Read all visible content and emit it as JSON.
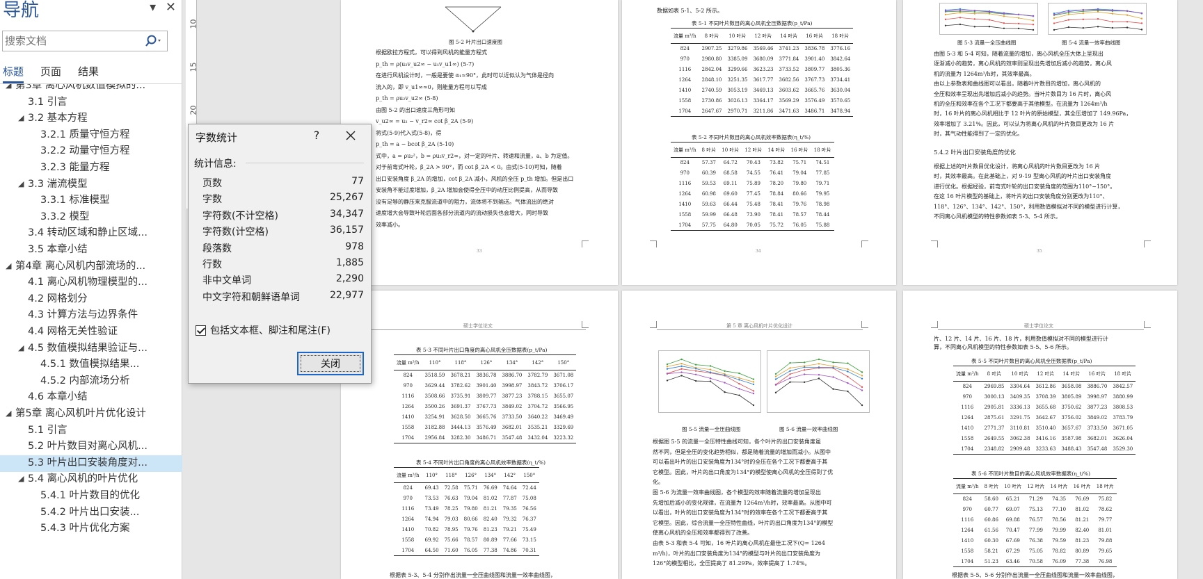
{
  "nav": {
    "title": "导航",
    "search_placeholder": "搜索文档",
    "tabs": [
      "标题",
      "页面",
      "结果"
    ],
    "items": [
      {
        "label": "第3章 离心风机数值模拟的...",
        "level": 1,
        "expanded": true
      },
      {
        "label": "3.1 引言",
        "level": 2
      },
      {
        "label": "3.2 基本方程",
        "level": 2,
        "expanded": true
      },
      {
        "label": "3.2.1 质量守恒方程",
        "level": 3
      },
      {
        "label": "3.2.2 动量守恒方程",
        "level": 3
      },
      {
        "label": "3.2.3 能量方程",
        "level": 3
      },
      {
        "label": "3.3 湍流模型",
        "level": 2,
        "expanded": true
      },
      {
        "label": "3.3.1 标准模型",
        "level": 3
      },
      {
        "label": "3.3.2 模型",
        "level": 3
      },
      {
        "label": "3.4 转动区域和静止区域...",
        "level": 2
      },
      {
        "label": "3.5 本章小结",
        "level": 2
      },
      {
        "label": "第4章 离心风机内部流场的...",
        "level": 1,
        "expanded": true
      },
      {
        "label": "4.1 离心风机物理模型的...",
        "level": 2
      },
      {
        "label": "4.2 网格划分",
        "level": 2
      },
      {
        "label": "4.3 计算方法与边界条件",
        "level": 2
      },
      {
        "label": "4.4 网格无关性验证",
        "level": 2
      },
      {
        "label": "4.5 数值模拟结果验证与...",
        "level": 2,
        "expanded": true
      },
      {
        "label": "4.5.1 数值模拟结果...",
        "level": 3
      },
      {
        "label": "4.5.2 内部流场分析",
        "level": 3
      },
      {
        "label": "4.6 本章小结",
        "level": 2
      },
      {
        "label": "第5章 离心风机叶片优化设计",
        "level": 1,
        "expanded": true
      },
      {
        "label": "5.1 引言",
        "level": 2
      },
      {
        "label": "5.2 叶片数目对离心风机...",
        "level": 2
      },
      {
        "label": "5.3 叶片出口安装角度对...",
        "level": 2,
        "selected": true
      },
      {
        "label": "5.4 离心风机的叶片优化",
        "level": 2,
        "expanded": true
      },
      {
        "label": "5.4.1 叶片数目的优化",
        "level": 3
      },
      {
        "label": "5.4.2 叶片出口安装...",
        "level": 3
      },
      {
        "label": "5.4.3 叶片优化方案",
        "level": 3
      }
    ]
  },
  "ruler": [
    "10",
    "15",
    "20"
  ],
  "dialog": {
    "title": "字数统计",
    "help": "?",
    "subtitle": "统计信息:",
    "stats": [
      {
        "label": "页数",
        "value": "77"
      },
      {
        "label": "字数",
        "value": "25,267"
      },
      {
        "label": "字符数(不计空格)",
        "value": "34,347"
      },
      {
        "label": "字符数(计空格)",
        "value": "36,157"
      },
      {
        "label": "段落数",
        "value": "978"
      },
      {
        "label": "行数",
        "value": "1,885"
      },
      {
        "label": "非中文单词",
        "value": "2,290"
      },
      {
        "label": "中文字符和朝鲜语单词",
        "value": "22,977"
      }
    ],
    "checkbox_label": "包括文本框、脚注和尾注(F)",
    "checkbox_checked": true,
    "close_label": "关闭"
  },
  "pages": {
    "p1": {
      "caption": "图 5-2 叶片出口速度图",
      "lines": [
        "根据欧拉方程式，可以得到风机的能量方程式",
        "p_th = ρ(u₂v_u2∞ − u₁v_u1∞)                         (5-7)",
        "在进行风机设计时，一般是要使 α₁≈90°，此时可以近似认为气体是径向",
        "流入的，即 v_u1∞≈0，则能量方程可以写成",
        "p_th = ρu₂v_u2∞                                      (5-8)",
        "由图 5-2 的出口速度三角形可知",
        "v_u2∞ = u₂ − v_r2∞ cot β_2A                          (5-9)",
        "将式(5-9)代入式(5-8)，得",
        "p_th = a − bcot β_2A                                 (5-10)",
        "式中，a = ρu₂²，b = ρu₂v_r2∞，对一定的叶片、转速和流量，a、b 为定值。",
        "对于前弯式叶轮，β_2A > 90°，而 cot β_2A < 0。由式(5-10)可知，随着",
        "出口安装角度 β_2A 的增加，cot β_2A 减小，风机的全压 p_th 增加。但是出口",
        "安装角不能过度增加，β_2A 增加会使得全压中的动压比例提高，从而导致",
        "没有足够的静压来克服流道中的阻力，流体将不到输送。气体流出的绝对",
        "速度增大会导致叶轮后面各部分流道内的流动损失也会增大，同时导致",
        "效率减小。"
      ],
      "footer": "33"
    },
    "p2": {
      "intro": "数据如表 5-1、5-2 所示。",
      "t1_caption": "表 5-1 不同叶片数目的离心风机全压数据表(p_t/Pa)",
      "t2_caption": "表 5-2 不同叶片数目的离心风机效率数据表(η_t/%)",
      "head": [
        "流量 m³/h",
        "8 叶片",
        "10 叶片",
        "12 叶片",
        "14 叶片",
        "16 叶片",
        "18 叶片"
      ],
      "t1_rows": [
        [
          "824",
          "2907.25",
          "3279.86",
          "3569.46",
          "3741.23",
          "3836.78",
          "3776.16"
        ],
        [
          "970",
          "2980.80",
          "3385.09",
          "3680.09",
          "3771.84",
          "3901.40",
          "3842.64"
        ],
        [
          "1116",
          "2842.04",
          "3299.66",
          "3623.23",
          "3733.52",
          "3809.77",
          "3805.36"
        ],
        [
          "1264",
          "2848.10",
          "3251.35",
          "3617.77",
          "3682.56",
          "3767.73",
          "3734.41"
        ],
        [
          "1410",
          "2740.59",
          "3053.19",
          "3469.13",
          "3603.62",
          "3665.76",
          "3630.04"
        ],
        [
          "1558",
          "2730.86",
          "3026.13",
          "3364.17",
          "3569.29",
          "3576.49",
          "3570.65"
        ],
        [
          "1704",
          "2647.67",
          "2970.71",
          "3211.86",
          "3471.63",
          "3486.71",
          "3478.94"
        ]
      ],
      "t2_rows": [
        [
          "824",
          "57.37",
          "64.72",
          "70.43",
          "73.82",
          "75.71",
          "74.51"
        ],
        [
          "970",
          "60.39",
          "68.58",
          "74.55",
          "76.41",
          "79.04",
          "77.85"
        ],
        [
          "1116",
          "59.53",
          "69.11",
          "75.89",
          "78.20",
          "79.80",
          "79.71"
        ],
        [
          "1264",
          "60.98",
          "69.60",
          "77.45",
          "78.84",
          "80.66",
          "79.95"
        ],
        [
          "1410",
          "59.63",
          "66.44",
          "75.48",
          "78.41",
          "79.76",
          "78.98"
        ],
        [
          "1558",
          "59.99",
          "66.48",
          "73.90",
          "78.41",
          "78.57",
          "78.44"
        ],
        [
          "1704",
          "57.75",
          "64.80",
          "70.05",
          "75.72",
          "76.05",
          "75.88"
        ]
      ],
      "footer": "34"
    },
    "p3": {
      "cap_a": "图 5-3 流量一全压曲线图",
      "cap_b": "图 5-4 流量一效率曲线图",
      "lines": [
        "由图 5-3 和 5-4 可知，随着流量的增加，离心风机全压大体上呈现出",
        "逐渐减小的趋势，离心风机的效率则呈现出先增加后减小的趋势，离心风",
        "机的流量为 1264m³/h时，其效率最高。",
        "由以上参数表和曲线图可以看出，随着叶片数目的增加，离心风机的",
        "全压和效率呈现出先增加后减小的趋势。当叶片数目为 16 片时，离心风",
        "机的全压和效率在各个工况下都要高于其他模型。在流量为 1264m³/h",
        "时，16 叶片的离心风机相比于 12 叶片的原始模型，其全压增加了 149.96Pa，",
        "效率增加了 3.21%。因此，可以认为将离心风机的叶片数目更改为 16 片",
        "时，其气动性能得到了一定的优化。"
      ],
      "section": "5.4.2 叶片出口安装角度的优化",
      "lines2": [
        "根据上述的叶片数目优化设计，将离心风机的叶片数目更改为 16 片",
        "时，其效率最高。在此基础上，对 9-19 型离心风机的叶片出口安装角度",
        "进行优化。根据经验，前弯式叶轮的出口安装角度的范围为110°~150°。",
        "在这 16 叶片模型的基础上，将叶片的出口安装角度分别更改为110°、",
        "118°、126°、134°、142°、150°，利用数值模拟对不同的模型进行计算，",
        "不同离心风机模型的特性参数如表 5-3、5-4 所示。"
      ],
      "footer": "35"
    },
    "p4": {
      "header": "硕士学位论文",
      "t3_caption": "表 5-3 不同叶片出口角度的离心风机全压数据表(p_t/Pa)",
      "t4_caption": "表 5-4 不同叶片出口角度的离心风机效率数据表(η_t/%)",
      "head": [
        "流量 m³/h",
        "110°",
        "118°",
        "126°",
        "134°",
        "142°",
        "150°"
      ],
      "t3_rows": [
        [
          "824",
          "3518.59",
          "3678.21",
          "3836.78",
          "3886.70",
          "3782.79",
          "3671.08"
        ],
        [
          "970",
          "3629.44",
          "3782.62",
          "3901.40",
          "3998.97",
          "3843.72",
          "3706.17"
        ],
        [
          "1116",
          "3508.66",
          "3735.91",
          "3809.77",
          "3877.23",
          "3788.15",
          "3655.07"
        ],
        [
          "1264",
          "3500.26",
          "3691.37",
          "3767.73",
          "3849.02",
          "3704.72",
          "3566.95"
        ],
        [
          "1410",
          "3254.91",
          "3628.50",
          "3665.76",
          "3733.50",
          "3640.22",
          "3469.49"
        ],
        [
          "1558",
          "3182.88",
          "3444.13",
          "3576.49",
          "3682.01",
          "3535.21",
          "3329.69"
        ],
        [
          "1704",
          "2956.84",
          "3282.30",
          "3486.71",
          "3547.48",
          "3432.04",
          "3223.32"
        ]
      ],
      "t4_rows": [
        [
          "824",
          "69.43",
          "72.58",
          "75.71",
          "76.69",
          "74.64",
          "72.44"
        ],
        [
          "970",
          "73.53",
          "76.63",
          "79.04",
          "81.02",
          "77.87",
          "75.08"
        ],
        [
          "1116",
          "73.49",
          "78.25",
          "79.80",
          "81.21",
          "79.35",
          "76.56"
        ],
        [
          "1264",
          "74.94",
          "79.03",
          "80.66",
          "82.40",
          "79.32",
          "76.37"
        ],
        [
          "1410",
          "70.82",
          "78.95",
          "79.76",
          "81.23",
          "79.21",
          "75.49"
        ],
        [
          "1558",
          "69.92",
          "75.66",
          "78.57",
          "80.89",
          "77.66",
          "73.15"
        ],
        [
          "1704",
          "64.50",
          "71.60",
          "76.05",
          "77.38",
          "74.86",
          "70.31"
        ]
      ],
      "tail": "根据表 5-3、5-4 分别作出流量一全压曲线图和流量一效率曲线图，"
    },
    "p5": {
      "header": "第 5 章 离心风机叶片优化设计",
      "cap_a": "图 5-5 流量一全压曲线图",
      "cap_b": "图 5-6 流量一效率曲线图",
      "lines": [
        "根据图 5-5 的流量一全压特性曲线可知，各个叶片的出口安装角度虽",
        "然不同，但是全压的变化趋势相似，都是随着流量的增加而减小。从图中",
        "可以看出叶片的出口安装角度为134°时的全压在各个工况下都要高于其",
        "它模型。因此，叶片的出口角度为134°的模型使离心风机的全压得到了优",
        "化。",
        "图 5-6 为流量一效率曲线图，各个模型的效率随着流量的增加呈现出",
        "先增加后减小的变化规律，在流量为 1264m³/h时，效率最高。从图中可",
        "以看出，叶片的出口安装角度为134°时的效率在各个工况下都要高于其",
        "它模型。因此，综合流量一全压特性曲线，叶片的出口角度为134°的模型",
        "使离心风机的全压和效率都得到了改善。",
        "由表 5-3 和表 5-4 可知，16 叶片的离心风机在最佳工况下(Q= 1264",
        "m³/h)，叶片的出口安装角度为134°的模型与叶片的出口安装角度为",
        "126°的模型相比，全压提高了 81.29Pa，效率提高了 1.74%。"
      ]
    },
    "p6": {
      "header": "硕士学位论文",
      "lines": [
        "片、12 片、14 片、16 片、18 片，利用数值模拟对不同的模型进行计",
        "算，不同离心风机模型的特性参数如表 5-5、5-6 所示。"
      ],
      "t5_caption": "表 5-5 不同叶片数目的离心风机全压数据表(p_t/Pa)",
      "t6_caption": "表 5-6 不同叶片数目的离心风机效率数据表(η_t/%)",
      "head": [
        "流量 m³/h",
        "8 叶片",
        "10 叶片",
        "12 叶片",
        "14 叶片",
        "16 叶片",
        "18 叶片"
      ],
      "t5_rows": [
        [
          "824",
          "2969.85",
          "3304.64",
          "3612.86",
          "3658.08",
          "3886.70",
          "3842.57"
        ],
        [
          "970",
          "3000.13",
          "3409.35",
          "3708.39",
          "3805.89",
          "3998.97",
          "3880.99"
        ],
        [
          "1116",
          "2905.81",
          "3336.13",
          "3655.68",
          "3750.62",
          "3877.23",
          "3808.53"
        ],
        [
          "1264",
          "2875.61",
          "3291.75",
          "3642.67",
          "3756.02",
          "3849.02",
          "3783.79"
        ],
        [
          "1410",
          "2771.37",
          "3110.81",
          "3510.40",
          "3657.67",
          "3733.50",
          "3671.05"
        ],
        [
          "1558",
          "2649.55",
          "3062.38",
          "3416.16",
          "3587.98",
          "3682.01",
          "3626.04"
        ],
        [
          "1704",
          "2348.82",
          "2909.48",
          "3233.63",
          "3488.43",
          "3547.48",
          "3529.30"
        ]
      ],
      "t6_rows": [
        [
          "824",
          "58.60",
          "65.21",
          "71.29",
          "74.35",
          "76.69",
          "75.82"
        ],
        [
          "970",
          "60.77",
          "69.07",
          "75.13",
          "77.10",
          "81.02",
          "78.62"
        ],
        [
          "1116",
          "60.86",
          "69.88",
          "76.57",
          "78.56",
          "81.21",
          "79.77"
        ],
        [
          "1264",
          "61.56",
          "70.47",
          "77.99",
          "79.99",
          "82.40",
          "81.01"
        ],
        [
          "1410",
          "60.30",
          "67.69",
          "76.38",
          "79.59",
          "81.23",
          "79.88"
        ],
        [
          "1558",
          "58.21",
          "67.29",
          "75.05",
          "78.82",
          "80.89",
          "79.65"
        ],
        [
          "1704",
          "51.23",
          "63.46",
          "70.58",
          "76.09",
          "77.38",
          "76.98"
        ]
      ],
      "tail": "根据表 5-5、5-6 分别作出流量一全压曲线图和流量一效率曲线图，"
    }
  }
}
